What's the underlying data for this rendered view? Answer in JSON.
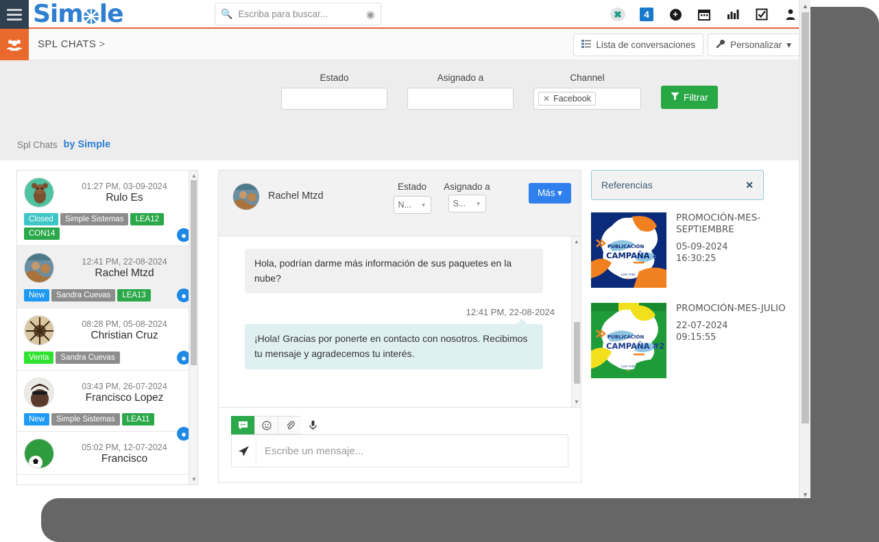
{
  "topbar": {
    "menu_icon": "hamburger-icon",
    "logo": {
      "part1": "Sim",
      "part2": "le"
    },
    "search": {
      "placeholder": "Escriba para buscar...",
      "value": "",
      "icon": "search-icon",
      "caret_icon": "chevron-down-circle-icon"
    },
    "icons": [
      {
        "name": "x-brand-icon",
        "glyph": "✖"
      },
      {
        "name": "notification-count-badge",
        "glyph": "4"
      },
      {
        "name": "plus-circle-icon",
        "glyph": "+"
      },
      {
        "name": "calendar-icon",
        "glyph": "▦"
      },
      {
        "name": "chart-icon",
        "glyph": "▥"
      },
      {
        "name": "checkbox-icon",
        "glyph": "☑"
      },
      {
        "name": "user-icon",
        "glyph": "👤"
      }
    ]
  },
  "breadcrumb": {
    "icon": "users-group-icon",
    "title": "SPL CHATS",
    "separator": ">",
    "actions": [
      {
        "name": "conversation-list-button",
        "label": "Lista de conversaciones",
        "icon": "list-icon"
      },
      {
        "name": "customize-button",
        "label": "Personalizar",
        "icon": "wrench-icon",
        "caret": "▾"
      }
    ]
  },
  "filters": {
    "estado": {
      "label": "Estado",
      "value": ""
    },
    "asignado": {
      "label": "Asignado a",
      "value": ""
    },
    "channel": {
      "label": "Channel",
      "chip": "Facebook",
      "chip_remove": "✕"
    },
    "filter_button": {
      "label": "Filtrar",
      "icon": "funnel-icon",
      "color": "#28a745"
    }
  },
  "subtitle": {
    "left": "Spl Chats",
    "right": "by Simple"
  },
  "conversations": [
    {
      "time": "01:27 PM, 03-09-2024",
      "name": "Rulo Es",
      "tags": [
        {
          "label": "Closed",
          "style": "t-closed"
        },
        {
          "label": "Simple Sistemas",
          "style": "t-gray"
        },
        {
          "label": "LEA12",
          "style": "t-green"
        },
        {
          "label": "CON14",
          "style": "t-green"
        }
      ],
      "channel_icon": "facebook-messenger-icon",
      "selected": false,
      "avatar_colors": [
        "#4fc3a1",
        "#7a5230"
      ]
    },
    {
      "time": "12:41 PM, 22-08-2024",
      "name": "Rachel Mtzd",
      "tags": [
        {
          "label": "New",
          "style": "t-new"
        },
        {
          "label": "Sandra Cuevas",
          "style": "t-gray"
        },
        {
          "label": "LEA13",
          "style": "t-green"
        }
      ],
      "channel_icon": "facebook-messenger-icon",
      "selected": true,
      "avatar_colors": [
        "#6b8ea0",
        "#c49a6c"
      ]
    },
    {
      "time": "08:28 PM, 05-08-2024",
      "name": "Christian Cruz",
      "tags": [
        {
          "label": "Venta",
          "style": "t-venta"
        },
        {
          "label": "Sandra Cuevas",
          "style": "t-gray"
        }
      ],
      "channel_icon": "facebook-messenger-icon",
      "selected": false,
      "avatar_colors": [
        "#d9c7a0",
        "#4a3520"
      ]
    },
    {
      "time": "03:43 PM, 26-07-2024",
      "name": "Francisco Lopez",
      "tags": [
        {
          "label": "New",
          "style": "t-new"
        },
        {
          "label": "Simple Sistemas",
          "style": "t-gray"
        },
        {
          "label": "LEA11",
          "style": "t-green"
        }
      ],
      "channel_icon": "facebook-messenger-icon",
      "selected": false,
      "avatar_colors": [
        "#e8e4e0",
        "#3a2a22"
      ]
    },
    {
      "time": "05:02 PM, 12-07-2024",
      "name": "Francisco",
      "tags": [],
      "channel_icon": "facebook-messenger-icon",
      "selected": false,
      "avatar_colors": [
        "#2e9b3e",
        "#ffffff"
      ]
    }
  ],
  "chat": {
    "contact_name": "Rachel Mtzd",
    "estado": {
      "label": "Estado",
      "value": "N...",
      "caret": "▾"
    },
    "asignado": {
      "label": "Asignado a",
      "value": "S...",
      "caret": "▾"
    },
    "more_button": {
      "label": "Más",
      "caret": "▾",
      "color": "#2f80ed"
    },
    "messages": [
      {
        "direction": "in",
        "text": "Hola, podrían darme más información de sus paquetes en la nube?"
      },
      {
        "direction": "out",
        "time": "12:41 PM, 22-08-2024",
        "text": "¡Hola! Gracias por ponerte en contacto con nosotros. Recibimos tu mensaje y agradecemos tu interés."
      }
    ],
    "composer": {
      "tools": [
        {
          "name": "message-tool-icon",
          "glyph": "💬",
          "active": true
        },
        {
          "name": "emoji-icon",
          "glyph": "☺",
          "active": false
        },
        {
          "name": "attachment-icon",
          "glyph": "📎",
          "active": false
        },
        {
          "name": "microphone-icon",
          "glyph": "🎤",
          "active": false
        }
      ],
      "send_icon": "send-icon",
      "placeholder": "Escribe un mensaje...",
      "value": ""
    }
  },
  "references": {
    "title": "Referencias",
    "close_icon": "✕",
    "items": [
      {
        "thumb_label_small": "PUBLICACIÓN",
        "thumb_label_big": "CAMPAÑA #1",
        "thumb_footer": "Leer más",
        "title": "PROMOCIÓN-MES-SEPTIEMBRE",
        "date": "05-09-2024",
        "time": "16:30:25",
        "colors": [
          "#0b2a7a",
          "#f08020",
          "#8fc4e0"
        ]
      },
      {
        "thumb_label_small": "PUBLICACIÓN",
        "thumb_label_big": "CAMPAÑA #2",
        "thumb_footer": "Leer más",
        "title": "PROMOCIÓN-MES-JULIO",
        "date": "22-07-2024",
        "time": "09:15:55",
        "colors": [
          "#1f9c3a",
          "#f2e01c",
          "#8fc4e0"
        ]
      }
    ]
  }
}
